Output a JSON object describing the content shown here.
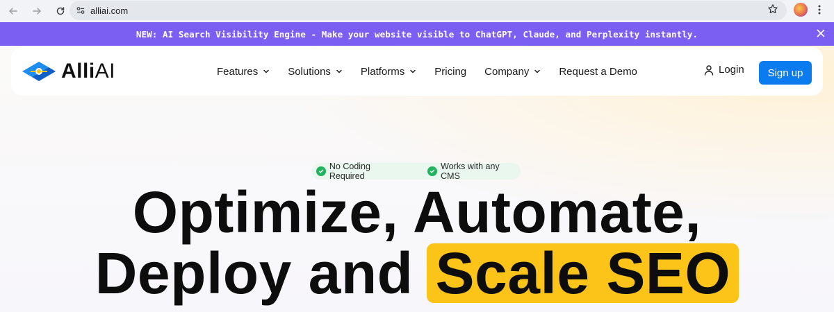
{
  "browser": {
    "url": "alliai.com",
    "icons": [
      "back-arrow-icon",
      "forward-arrow-icon",
      "reload-icon",
      "site-info-icon",
      "star-icon",
      "profile-avatar",
      "kebab-menu-icon"
    ]
  },
  "announcement": {
    "text": "NEW: AI Search Visibility Engine - Make your website visible to ChatGPT, Claude, and Perplexity instantly.",
    "background": "#7b5ff2"
  },
  "navbar": {
    "logo": {
      "bold": "Alli",
      "light": "AI"
    },
    "items": [
      {
        "label": "Features",
        "dropdown": true
      },
      {
        "label": "Solutions",
        "dropdown": true
      },
      {
        "label": "Platforms",
        "dropdown": true
      },
      {
        "label": "Pricing",
        "dropdown": false
      },
      {
        "label": "Company",
        "dropdown": true
      },
      {
        "label": "Request a Demo",
        "dropdown": false
      }
    ],
    "login": "Login",
    "signup": "Sign up",
    "accent": "#0a7cf0"
  },
  "hero": {
    "badges": [
      "No Coding Required",
      "Works with any CMS"
    ],
    "headline_line1": "Optimize, Automate,",
    "headline_line2_plain": "Deploy and",
    "headline_line2_highlight": "Scale SEO",
    "highlight_color": "#fcc419"
  }
}
